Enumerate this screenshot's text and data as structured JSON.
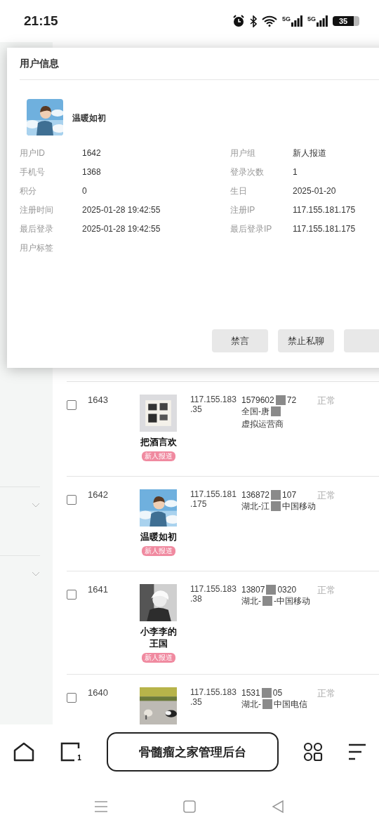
{
  "status_bar": {
    "time": "21:15",
    "signals": [
      {
        "label": "5G"
      },
      {
        "label": "5G"
      }
    ],
    "battery": "35"
  },
  "table": {
    "rows": [
      {
        "checked": false,
        "id": "1643",
        "name": "把酒言欢",
        "badge": "新人报道",
        "ip": "117.155.183.35",
        "phone_start": "1579602",
        "phone_end": "72",
        "location_start": "全国-唐",
        "location_end": "虚拟运营商",
        "status": "正常"
      },
      {
        "checked": false,
        "id": "1642",
        "name": "温暖如初",
        "badge": "新人报道",
        "ip": "117.155.181.175",
        "phone_start": "136872",
        "phone_end": "107",
        "location_start": "湖北-江",
        "location_end": "中国移动",
        "status": "正常"
      },
      {
        "checked": false,
        "id": "1641",
        "name": "小李李的王国",
        "badge": "新人报道",
        "ip": "117.155.183.38",
        "phone_start": "13807",
        "phone_end": "0320",
        "location_start": "湖北-",
        "location_end": "-中国移动",
        "status": "正常"
      },
      {
        "checked": false,
        "id": "1640",
        "ip": "117.155.183.35",
        "phone_start": "1531",
        "phone_end": "05",
        "location_start": "湖北-",
        "location_end": "中国电信",
        "status": "正常"
      }
    ]
  },
  "dialog": {
    "title": "用户信息",
    "user": {
      "name": "温暖如初"
    },
    "fields": [
      {
        "label": "用户ID",
        "value": "1642"
      },
      {
        "label": "用户组",
        "value": "新人报道"
      },
      {
        "label": "手机号",
        "value": "1368"
      },
      {
        "label": "登录次数",
        "value": "1"
      },
      {
        "label": "积分",
        "value": "0"
      },
      {
        "label": "生日",
        "value": "2025-01-20"
      },
      {
        "label": "注册时间",
        "value": "2025-01-28 19:42:55"
      },
      {
        "label": "注册IP",
        "value": "117.155.181.175"
      },
      {
        "label": "最后登录",
        "value": "2025-01-28 19:42:55"
      },
      {
        "label": "最后登录IP",
        "value": "117.155.181.175"
      },
      {
        "label": "用户标签"
      }
    ],
    "buttons": [
      {
        "label": "禁言"
      },
      {
        "label": "禁止私聊"
      }
    ]
  },
  "browser_bar": {
    "tab_count": "1",
    "title": "骨髓瘤之家管理后台"
  }
}
